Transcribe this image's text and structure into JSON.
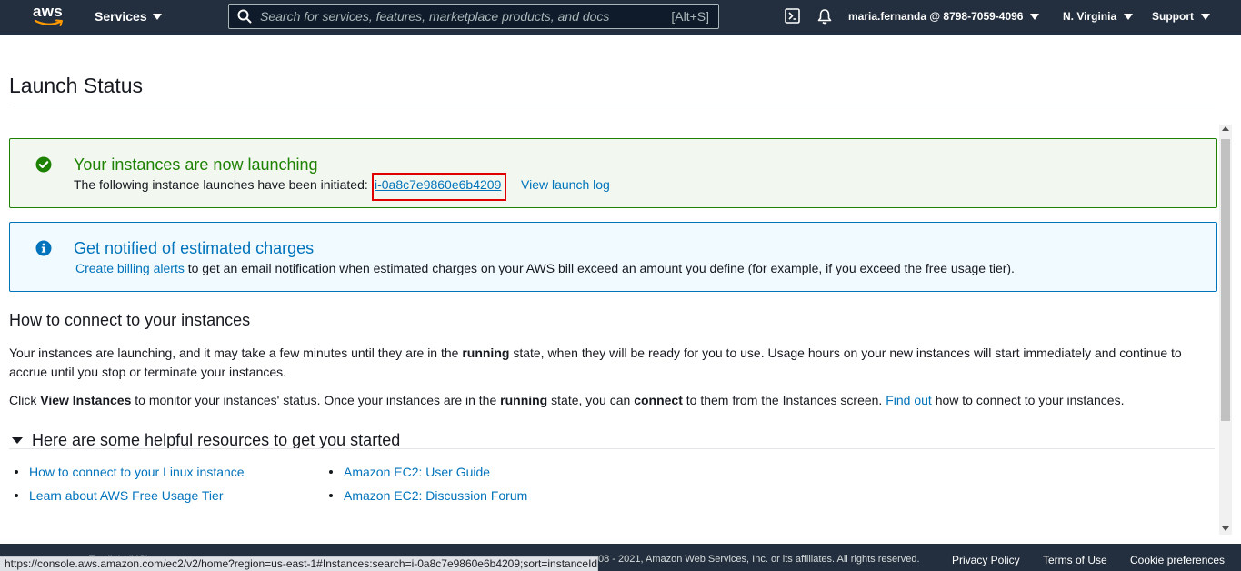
{
  "topnav": {
    "logo_text": "aws",
    "services_label": "Services",
    "search_placeholder": "Search for services, features, marketplace products, and docs",
    "search_shortcut": "[Alt+S]",
    "account": "maria.fernanda @ 8798-7059-4096",
    "region": "N. Virginia",
    "support": "Support",
    "bg_color": "#232f3e"
  },
  "page": {
    "title": "Launch Status"
  },
  "success_alert": {
    "title": "Your instances are now launching",
    "body_prefix": "The following instance launches have been initiated:",
    "instance_id": "i-0a8c7e9860e6b4209",
    "view_log_label": "View launch log",
    "color": "#1d8102"
  },
  "info_alert": {
    "title": "Get notified of estimated charges",
    "link_label": "Create billing alerts",
    "body_suffix": "to get an email notification when estimated charges on your AWS bill exceed an amount you define (for example, if you exceed the free usage tier).",
    "color": "#0073bb"
  },
  "connect_section": {
    "heading": "How to connect to your instances",
    "para1_a": "Your instances are launching, and it may take a few minutes until they are in the ",
    "para1_bold": "running",
    "para1_b": " state, when they will be ready for you to use. Usage hours on your new instances will start immediately and continue to accrue until you stop or terminate your instances.",
    "para2_a": "Click ",
    "para2_bold1": "View Instances",
    "para2_b": " to monitor your instances' status. Once your instances are in the ",
    "para2_bold2": "running",
    "para2_c": " state, you can ",
    "para2_bold3": "connect",
    "para2_d": " to them from the Instances screen. ",
    "para2_link": "Find out",
    "para2_e": " how to connect to your instances."
  },
  "resources": {
    "heading": "Here are some helpful resources to get you started",
    "left": [
      "How to connect to your Linux instance",
      "Learn about AWS Free Usage Tier"
    ],
    "right": [
      "Amazon EC2: User Guide",
      "Amazon EC2: Discussion Forum"
    ]
  },
  "footer": {
    "obscured_text": "English (US)",
    "copyright": "08 - 2021, Amazon Web Services, Inc. or its affiliates. All rights reserved.",
    "privacy": "Privacy Policy",
    "terms": "Terms of Use",
    "cookies": "Cookie preferences"
  },
  "status_bar": {
    "url": "https://console.aws.amazon.com/ec2/v2/home?region=us-east-1#Instances:search=i-0a8c7e9860e6b4209;sort=instanceId"
  }
}
